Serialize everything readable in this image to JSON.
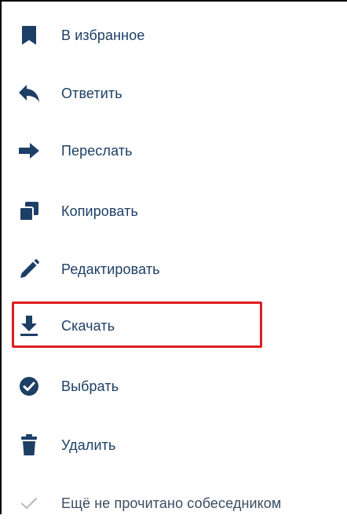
{
  "menu": {
    "items": [
      {
        "label": "В избранное",
        "icon": "bookmark-icon"
      },
      {
        "label": "Ответить",
        "icon": "reply-icon"
      },
      {
        "label": "Переслать",
        "icon": "forward-arrow-icon"
      },
      {
        "label": "Копировать",
        "icon": "copy-icon"
      },
      {
        "label": "Редактировать",
        "icon": "pencil-icon"
      },
      {
        "label": "Скачать",
        "icon": "download-icon"
      },
      {
        "label": "Выбрать",
        "icon": "check-circle-icon"
      },
      {
        "label": "Удалить",
        "icon": "trash-icon"
      },
      {
        "label": "Ещё не прочитано собеседником",
        "icon": "checkmark-icon"
      }
    ],
    "highlighted_item": "Скачать"
  },
  "colors": {
    "icon": "#1d3f66",
    "text": "#1d3f66",
    "muted_icon": "#b5bcc4",
    "highlight_border": "#e01e1e"
  }
}
